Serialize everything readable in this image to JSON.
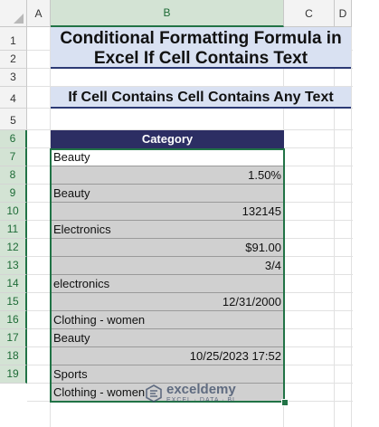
{
  "columns": [
    "A",
    "B",
    "C",
    "D"
  ],
  "rows": [
    "1",
    "2",
    "3",
    "4",
    "5",
    "6",
    "7",
    "8",
    "9",
    "10",
    "11",
    "12",
    "13",
    "14",
    "15",
    "16",
    "17",
    "18",
    "19"
  ],
  "title": "Conditional Formatting Formula in Excel If Cell Contains Text",
  "title_line1": "Conditional Formatting Formula in",
  "title_line2": "Excel If Cell Contains Text",
  "subtitle": "If Cell Contains Cell Contains Any Text",
  "table": {
    "header": "Category",
    "cells": [
      {
        "value": "Beauty",
        "align": "left",
        "fill": "white"
      },
      {
        "value": "1.50%",
        "align": "right",
        "fill": "gray"
      },
      {
        "value": "Beauty",
        "align": "left",
        "fill": "gray"
      },
      {
        "value": "132145",
        "align": "right",
        "fill": "gray"
      },
      {
        "value": "Electronics",
        "align": "left",
        "fill": "gray"
      },
      {
        "value": "$91.00",
        "align": "right",
        "fill": "gray"
      },
      {
        "value": "3/4",
        "align": "right",
        "fill": "gray"
      },
      {
        "value": "electronics",
        "align": "left",
        "fill": "gray"
      },
      {
        "value": "12/31/2000",
        "align": "right",
        "fill": "gray"
      },
      {
        "value": "Clothing - women",
        "align": "left",
        "fill": "gray"
      },
      {
        "value": "Beauty",
        "align": "left",
        "fill": "gray"
      },
      {
        "value": "10/25/2023 17:52",
        "align": "right",
        "fill": "gray"
      },
      {
        "value": "Sports",
        "align": "left",
        "fill": "gray"
      },
      {
        "value": "Clothing - women",
        "align": "left",
        "fill": "gray"
      }
    ]
  },
  "watermark": {
    "name": "exceldemy",
    "tagline": "EXCEL · DATA · BI"
  },
  "colors": {
    "header_fill": "#2c2e63",
    "title_fill": "#d9e1f2",
    "highlight_fill": "#d0d0d0",
    "selection": "#217346"
  }
}
